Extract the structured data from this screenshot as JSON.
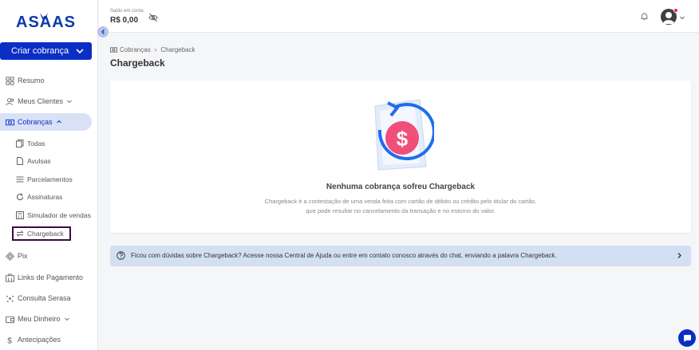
{
  "brand": {
    "logo_text": "ASAAS",
    "accent": "#0b2ec4"
  },
  "topbar": {
    "balance_label": "Saldo em conta",
    "balance_value": "R$ 0,00"
  },
  "sidebar": {
    "create_button": "Criar cobrança",
    "items": [
      {
        "label": "Resumo",
        "icon": "dashboard-icon"
      },
      {
        "label": "Meus Clientes",
        "icon": "users-icon"
      },
      {
        "label": "Cobranças",
        "icon": "billing-icon"
      },
      {
        "label": "Pix",
        "icon": "pix-icon"
      },
      {
        "label": "Links de Pagamento",
        "icon": "link-icon"
      },
      {
        "label": "Consulta Serasa",
        "icon": "serasa-icon"
      },
      {
        "label": "Meu Dinheiro",
        "icon": "wallet-icon"
      },
      {
        "label": "Antecipações",
        "icon": "dollar-icon"
      }
    ],
    "sub_items": [
      {
        "label": "Todas"
      },
      {
        "label": "Avulsas"
      },
      {
        "label": "Parcelamentos"
      },
      {
        "label": "Assinaturas"
      },
      {
        "label": "Simulador de vendas"
      },
      {
        "label": "Chargeback"
      }
    ]
  },
  "breadcrumb": {
    "parent": "Cobranças",
    "current": "Chargeback"
  },
  "page": {
    "title": "Chargeback",
    "empty_title": "Nenhuma cobrança sofreu Chargeback",
    "empty_desc": "Chargeback é a contestação de uma venda feita com cartão de débito ou crédito pelo titular do cartão, que pode resultar no cancelamento da transação e no estorno do valor."
  },
  "help": {
    "text": "Ficou com dúvidas sobre Chargeback? Acesse nossa Central de Ajuda ou entre em contato conosco através do chat, enviando a palavra Chargeback."
  }
}
